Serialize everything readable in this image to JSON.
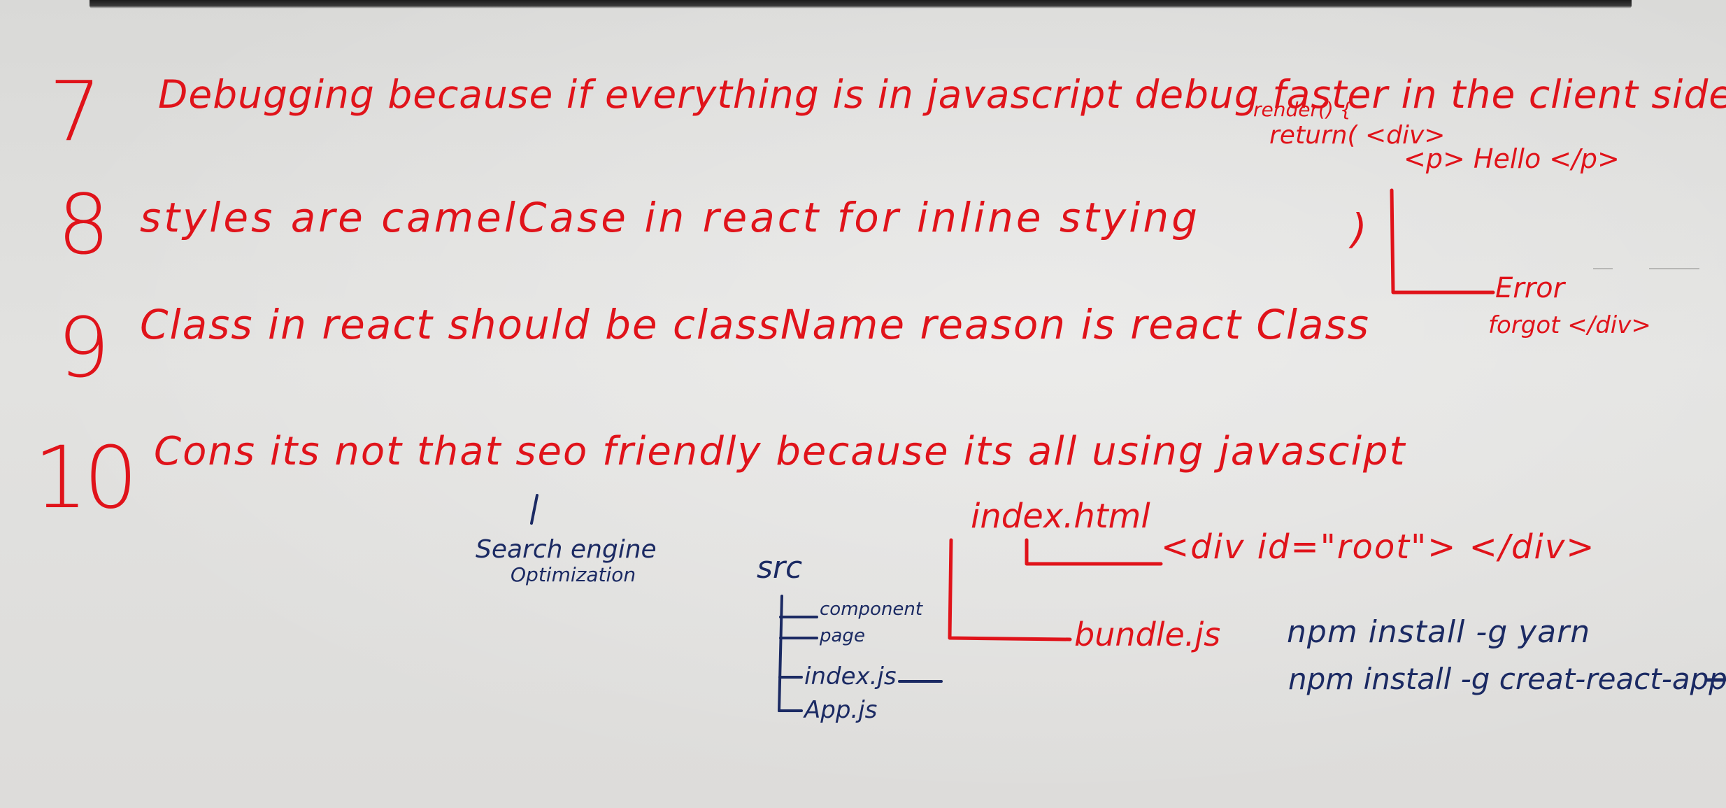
{
  "board": {
    "items": [
      {
        "number": "7",
        "text": "Debugging because if everything is in javascript debug faster in the client side"
      },
      {
        "number": "8",
        "text": "styles are camelCase in react for inline stying"
      },
      {
        "number": "9",
        "text": "Class in react should be className reason is react Class"
      },
      {
        "number": "10",
        "text": "Cons its not that seo friendly because its all using javascipt"
      }
    ],
    "seo_note": [
      "Search engine",
      "Optimization"
    ],
    "render_example": {
      "line1": "render() {",
      "line2": "return( <div>",
      "line3": "<p> Hello </p>",
      "line4": ")",
      "error": "Error",
      "error_note": "forgot </div>"
    },
    "file_tree": {
      "root": "src",
      "items": [
        "component",
        "page",
        "index.js",
        "App.js"
      ]
    },
    "index_diagram": {
      "index_html": "index.html",
      "root_div": "<div id=\"root\"> </div>",
      "bundle": "bundle.js"
    },
    "commands": [
      "npm install -g yarn",
      "npm install -g creat-react-app"
    ],
    "colors": {
      "red_marker": "#e0131a",
      "blue_marker": "#1b2a63",
      "board": "#dcdcda"
    }
  }
}
